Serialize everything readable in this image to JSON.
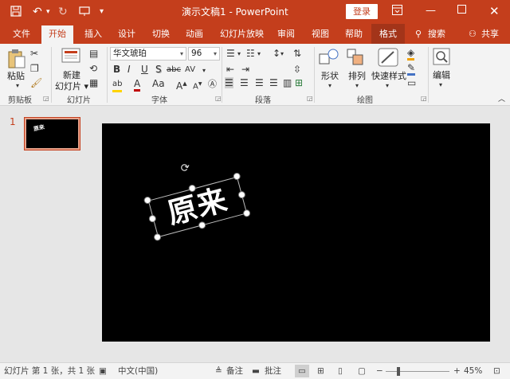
{
  "titlebar": {
    "title": "演示文稿1  -  PowerPoint",
    "login": "登录",
    "icons": [
      "save-icon",
      "undo-icon",
      "redo-icon",
      "customize-qat-icon",
      "ribbon-display-icon",
      "minimize-icon",
      "maximize-icon",
      "close-icon"
    ]
  },
  "tabs": {
    "file": "文件",
    "home": "开始",
    "insert": "插入",
    "design": "设计",
    "transitions": "切换",
    "animations": "动画",
    "slideshow": "幻灯片放映",
    "review": "审阅",
    "view": "视图",
    "help": "帮助",
    "format": "格式",
    "search": "搜索",
    "share": "共享"
  },
  "ribbon": {
    "clipboard": {
      "label": "剪贴板",
      "paste": "粘贴"
    },
    "slides": {
      "label": "幻灯片",
      "new_slide": "新建\n幻灯片"
    },
    "font": {
      "label": "字体",
      "font_name": "华文琥珀",
      "font_size": "96",
      "bold": "B",
      "italic": "I",
      "underline": "U",
      "shadow": "S",
      "strike": "abc",
      "spacing": "AV",
      "case": "Aa",
      "grow": "A",
      "shrink": "A"
    },
    "paragraph": {
      "label": "段落"
    },
    "drawing": {
      "label": "绘图",
      "shapes": "形状",
      "arrange": "排列",
      "quick_styles": "快速样式"
    },
    "editing": {
      "label": "",
      "edit": "编辑"
    }
  },
  "thumbnail": {
    "number": "1",
    "text": "原来"
  },
  "slide": {
    "text": "原来"
  },
  "statusbar": {
    "slide_info": "幻灯片 第 1 张，共 1 张",
    "language": "中文(中国)",
    "notes": "备注",
    "comments": "批注",
    "zoom_value": "45%",
    "zoom_level": 0.45
  },
  "colors": {
    "accent": "#c43e1c",
    "format_tab": "#a33419",
    "slide_bg": "#000000"
  }
}
